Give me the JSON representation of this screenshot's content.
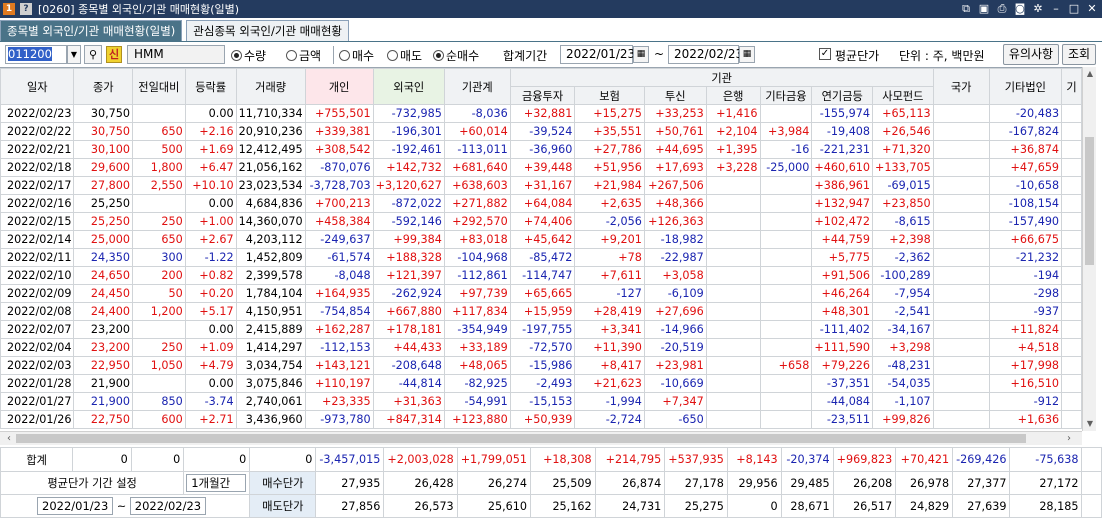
{
  "window": {
    "title_prefix_icon": "1",
    "help_icon": "?",
    "title": "[0260] 종목별 외국인/기관 매매현황(일별)"
  },
  "tabs": [
    {
      "label": "종목별 외국인/기관 매매현황(일별)",
      "active": true
    },
    {
      "label": "관심종목 외국인/기관 매매현황",
      "active": false
    }
  ],
  "toolbar": {
    "code": "011200",
    "badge": "신",
    "stock_name": "HMM",
    "radio_qty": "수량",
    "radio_amt": "금액",
    "radio_buy": "매수",
    "radio_sell": "매도",
    "radio_net": "순매수",
    "period_label": "합계기간",
    "date_from": "2022/01/23",
    "tilde": "~",
    "date_to": "2022/02/23",
    "avg_price_label": "평균단가",
    "avg_price_checked": true,
    "unit_label": "단위 : 주, 백만원",
    "notice_button": "유의사항",
    "query_button": "조회"
  },
  "columns": {
    "date": "일자",
    "close": "종가",
    "change": "전일대비",
    "rate": "등락률",
    "volume": "거래량",
    "individual": "개인",
    "foreign": "외국인",
    "institution_total": "기관계",
    "institution_group": "기관",
    "fin_invest": "금융투자",
    "insurance": "보험",
    "trust": "투신",
    "bank": "은행",
    "other_fin": "기타금융",
    "pension": "연기금등",
    "private_fund": "사모펀드",
    "nation": "국가",
    "other_corp": "기타법인",
    "next_partial": "기"
  },
  "rows": [
    [
      "2022/02/23",
      "30,750",
      "",
      "0.00",
      "11,710,334",
      "+755,501",
      "-732,985",
      "-8,036",
      "+32,881",
      "+15,275",
      "+33,253",
      "+1,416",
      "",
      "-155,974",
      "+65,113",
      "",
      "-20,483"
    ],
    [
      "2022/02/22",
      "30,750",
      "650",
      "+2.16",
      "20,910,236",
      "+339,381",
      "-196,301",
      "+60,014",
      "-39,524",
      "+35,551",
      "+50,761",
      "+2,104",
      "+3,984",
      "-19,408",
      "+26,546",
      "",
      "-167,824"
    ],
    [
      "2022/02/21",
      "30,100",
      "500",
      "+1.69",
      "12,412,495",
      "+308,542",
      "-192,461",
      "-113,011",
      "-36,960",
      "+27,786",
      "+44,695",
      "+1,395",
      "-16",
      "-221,231",
      "+71,320",
      "",
      "+36,874"
    ],
    [
      "2022/02/18",
      "29,600",
      "1,800",
      "+6.47",
      "21,056,162",
      "-870,076",
      "+142,732",
      "+681,640",
      "+39,448",
      "+51,956",
      "+17,693",
      "+3,228",
      "-25,000",
      "+460,610",
      "+133,705",
      "",
      "+47,659"
    ],
    [
      "2022/02/17",
      "27,800",
      "2,550",
      "+10.10",
      "23,023,534",
      "-3,728,703",
      "+3,120,627",
      "+638,603",
      "+31,167",
      "+21,984",
      "+267,506",
      "",
      "",
      "+386,961",
      "-69,015",
      "",
      "-10,658"
    ],
    [
      "2022/02/16",
      "25,250",
      "",
      "0.00",
      "4,684,836",
      "+700,213",
      "-872,022",
      "+271,882",
      "+64,084",
      "+2,635",
      "+48,366",
      "",
      "",
      "+132,947",
      "+23,850",
      "",
      "-108,154"
    ],
    [
      "2022/02/15",
      "25,250",
      "250",
      "+1.00",
      "14,360,070",
      "+458,384",
      "-592,146",
      "+292,570",
      "+74,406",
      "-2,056",
      "+126,363",
      "",
      "",
      "+102,472",
      "-8,615",
      "",
      "-157,490"
    ],
    [
      "2022/02/14",
      "25,000",
      "650",
      "+2.67",
      "4,203,112",
      "-249,637",
      "+99,384",
      "+83,018",
      "+45,642",
      "+9,201",
      "-18,982",
      "",
      "",
      "+44,759",
      "+2,398",
      "",
      "+66,675"
    ],
    [
      "2022/02/11",
      "24,350",
      "300",
      "-1.22",
      "1,452,809",
      "-61,574",
      "+188,328",
      "-104,968",
      "-85,472",
      "+78",
      "-22,987",
      "",
      "",
      "+5,775",
      "-2,362",
      "",
      "-21,232"
    ],
    [
      "2022/02/10",
      "24,650",
      "200",
      "+0.82",
      "2,399,578",
      "-8,048",
      "+121,397",
      "-112,861",
      "-114,747",
      "+7,611",
      "+3,058",
      "",
      "",
      "+91,506",
      "-100,289",
      "",
      "-194"
    ],
    [
      "2022/02/09",
      "24,450",
      "50",
      "+0.20",
      "1,784,104",
      "+164,935",
      "-262,924",
      "+97,739",
      "+65,665",
      "-127",
      "-6,109",
      "",
      "",
      "+46,264",
      "-7,954",
      "",
      "-298"
    ],
    [
      "2022/02/08",
      "24,400",
      "1,200",
      "+5.17",
      "4,150,951",
      "-754,854",
      "+667,880",
      "+117,834",
      "+15,959",
      "+28,419",
      "+27,696",
      "",
      "",
      "+48,301",
      "-2,541",
      "",
      "-937"
    ],
    [
      "2022/02/07",
      "23,200",
      "",
      "0.00",
      "2,415,889",
      "+162,287",
      "+178,181",
      "-354,949",
      "-197,755",
      "+3,341",
      "-14,966",
      "",
      "",
      "-111,402",
      "-34,167",
      "",
      "+11,824"
    ],
    [
      "2022/02/04",
      "23,200",
      "250",
      "+1.09",
      "1,414,297",
      "-112,153",
      "+44,433",
      "+33,189",
      "-72,570",
      "+11,390",
      "-20,519",
      "",
      "",
      "+111,590",
      "+3,298",
      "",
      "+4,518"
    ],
    [
      "2022/02/03",
      "22,950",
      "1,050",
      "+4.79",
      "3,034,754",
      "+143,121",
      "-208,648",
      "+48,065",
      "-15,986",
      "+8,417",
      "+23,981",
      "",
      "+658",
      "+79,226",
      "-48,231",
      "",
      "+17,998"
    ],
    [
      "2022/01/28",
      "21,900",
      "",
      "0.00",
      "3,075,846",
      "+110,197",
      "-44,814",
      "-82,925",
      "-2,493",
      "+21,623",
      "-10,669",
      "",
      "",
      "-37,351",
      "-54,035",
      "",
      "+16,510"
    ],
    [
      "2022/01/27",
      "21,900",
      "850",
      "-3.74",
      "2,740,061",
      "+23,335",
      "+31,363",
      "-54,991",
      "-15,153",
      "-1,994",
      "+7,347",
      "",
      "",
      "-44,084",
      "-1,107",
      "",
      "-912"
    ],
    [
      "2022/01/26",
      "22,750",
      "600",
      "+2.71",
      "3,436,960",
      "-973,780",
      "+847,314",
      "+123,880",
      "+50,939",
      "-2,724",
      "-650",
      "",
      "",
      "-23,511",
      "+99,826",
      "",
      "+1,636"
    ]
  ],
  "row_colors": [
    "none",
    "up",
    "up",
    "up",
    "up",
    "none",
    "up",
    "up",
    "down",
    "up",
    "up",
    "up",
    "none",
    "up",
    "up",
    "none",
    "down",
    "up"
  ],
  "totals": {
    "label": "합계",
    "values": [
      "0",
      "0",
      "0",
      "0",
      "-3,457,015",
      "+2,003,028",
      "+1,799,051",
      "+18,308",
      "+214,795",
      "+537,935",
      "+8,143",
      "-20,374",
      "+969,823",
      "+70,421",
      "-269,426",
      "-75,638"
    ]
  },
  "avg_period": {
    "label": "평균단가 기간 설정",
    "select_value": "1개월간",
    "from": "2022/01/23",
    "tilde": "~",
    "to": "2022/02/23",
    "buy_label": "매수단가",
    "sell_label": "매도단가",
    "buy_values": [
      "27,935",
      "26,428",
      "26,274",
      "25,509",
      "26,874",
      "27,178",
      "29,956",
      "29,485",
      "26,208",
      "26,978",
      "27,377",
      "27,172"
    ],
    "sell_values": [
      "27,856",
      "26,573",
      "25,610",
      "25,162",
      "24,731",
      "25,275",
      "0",
      "28,671",
      "26,517",
      "24,829",
      "27,639",
      "28,185"
    ]
  },
  "colors": {
    "up": "#e01010",
    "down": "#1a24b0",
    "title_bar": "#243b5f",
    "active_tab": "#4a7388"
  }
}
